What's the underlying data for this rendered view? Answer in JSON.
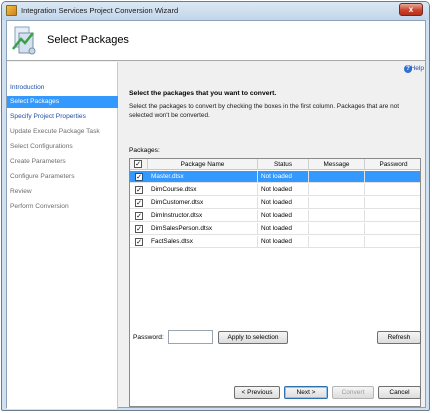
{
  "window": {
    "title": "Integration Services Project Conversion Wizard",
    "close_label": "x"
  },
  "header": {
    "title": "Select Packages"
  },
  "sidebar": {
    "items": [
      {
        "label": "Introduction",
        "state": "link"
      },
      {
        "label": "Select Packages",
        "state": "active"
      },
      {
        "label": "Specify Project Properties",
        "state": "link"
      },
      {
        "label": "Update Execute Package Task",
        "state": "dim"
      },
      {
        "label": "Select Configurations",
        "state": "dim"
      },
      {
        "label": "Create Parameters",
        "state": "dim"
      },
      {
        "label": "Configure Parameters",
        "state": "dim"
      },
      {
        "label": "Review",
        "state": "dim"
      },
      {
        "label": "Perform Conversion",
        "state": "dim"
      }
    ]
  },
  "help": {
    "label": "Help",
    "icon": "?"
  },
  "instructions": {
    "title": "Select the packages that you want to convert.",
    "text": "Select the packages to convert by checking the boxes in the first column. Packages that are not selected won't be converted."
  },
  "packages": {
    "label": "Packages:",
    "columns": [
      "",
      "Package Name",
      "Status",
      "Message",
      "Password"
    ],
    "rows": [
      {
        "checked": "✓",
        "name": "Master.dtsx",
        "status": "Not loaded",
        "message": "",
        "password": ""
      },
      {
        "checked": "✓",
        "name": "DimCourse.dtsx",
        "status": "Not loaded",
        "message": "",
        "password": ""
      },
      {
        "checked": "✓",
        "name": "DimCustomer.dtsx",
        "status": "Not loaded",
        "message": "",
        "password": ""
      },
      {
        "checked": "✓",
        "name": "DimInstructor.dtsx",
        "status": "Not loaded",
        "message": "",
        "password": ""
      },
      {
        "checked": "✓",
        "name": "DimSalesPerson.dtsx",
        "status": "Not loaded",
        "message": "",
        "password": ""
      },
      {
        "checked": "✓",
        "name": "FactSales.dtsx",
        "status": "Not loaded",
        "message": "",
        "password": ""
      }
    ],
    "header_checked": "✓"
  },
  "password": {
    "label": "Password:",
    "value": "",
    "apply_label": "Apply to selection",
    "refresh_label": "Refresh"
  },
  "buttons": {
    "previous": "< Previous",
    "next": "Next >",
    "convert": "Convert",
    "cancel": "Cancel"
  },
  "colors": {
    "selection": "#3399ff",
    "link": "#1f4fa8"
  }
}
